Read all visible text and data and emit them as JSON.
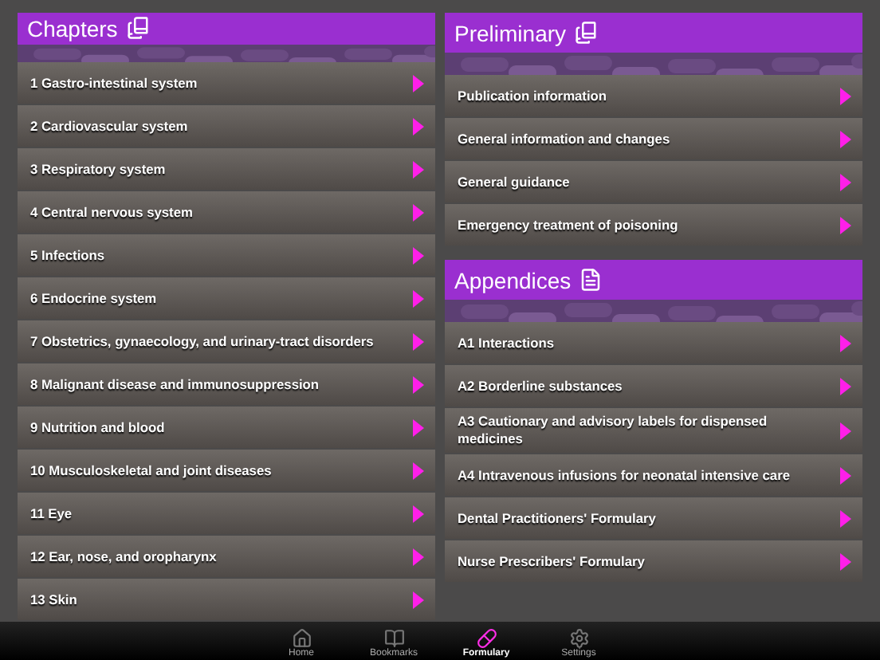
{
  "chapters": {
    "title": "Chapters",
    "items": [
      {
        "label": "1 Gastro-intestinal system"
      },
      {
        "label": "2 Cardiovascular system"
      },
      {
        "label": "3 Respiratory system"
      },
      {
        "label": "4 Central nervous system"
      },
      {
        "label": "5 Infections"
      },
      {
        "label": "6 Endocrine system"
      },
      {
        "label": "7 Obstetrics, gynaecology, and urinary-tract disorders"
      },
      {
        "label": "8 Malignant disease and immunosuppression"
      },
      {
        "label": "9 Nutrition and blood"
      },
      {
        "label": "10 Musculoskeletal and joint diseases"
      },
      {
        "label": "11 Eye"
      },
      {
        "label": "12 Ear, nose, and oropharynx"
      },
      {
        "label": "13 Skin"
      }
    ]
  },
  "preliminary": {
    "title": "Preliminary",
    "items": [
      {
        "label": "Publication information"
      },
      {
        "label": "General information and changes"
      },
      {
        "label": "General guidance"
      },
      {
        "label": "Emergency treatment of poisoning"
      }
    ]
  },
  "appendices": {
    "title": "Appendices",
    "items": [
      {
        "label": "A1 Interactions"
      },
      {
        "label": "A2 Borderline substances"
      },
      {
        "label": "A3 Cautionary and advisory labels for dispensed medicines"
      },
      {
        "label": "A4 Intravenous infusions for neonatal intensive care"
      },
      {
        "label": "Dental Practitioners' Formulary"
      },
      {
        "label": "Nurse Prescribers' Formulary"
      }
    ]
  },
  "tab_bar": [
    {
      "kind": "home",
      "label": "Home",
      "selected": false
    },
    {
      "kind": "bookmarks",
      "label": "Bookmarks",
      "selected": false
    },
    {
      "kind": "formulary",
      "label": "Formulary",
      "selected": true
    },
    {
      "kind": "settings",
      "label": "Settings",
      "selected": false
    }
  ]
}
